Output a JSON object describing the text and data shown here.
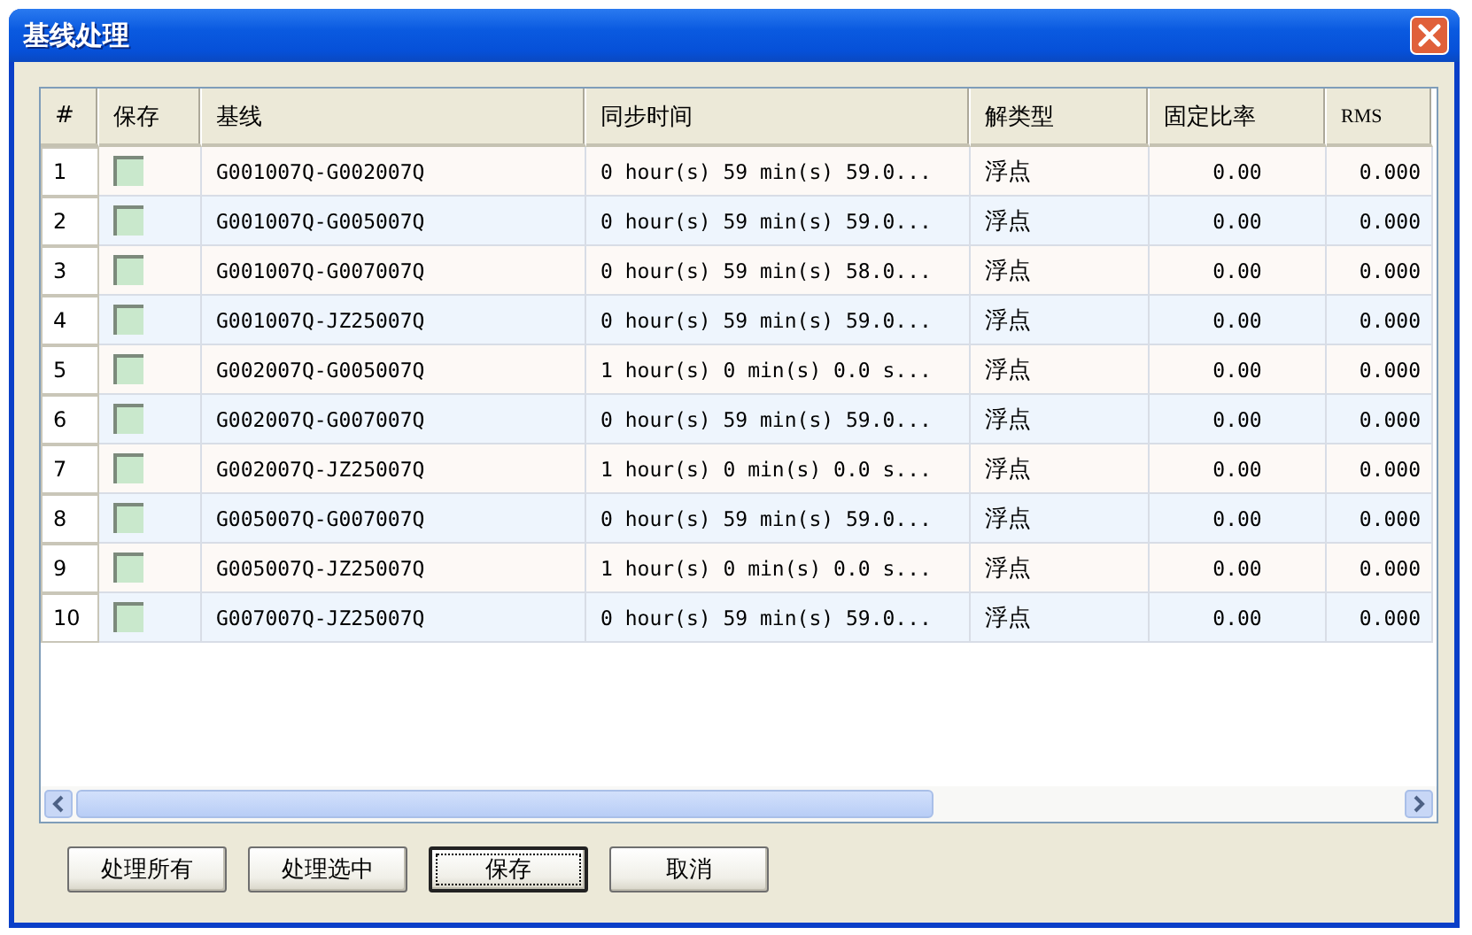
{
  "window": {
    "title": "基线处理"
  },
  "table": {
    "columns": [
      "#",
      "保存",
      "基线",
      "同步时间",
      "解类型",
      "固定比率",
      "RMS"
    ],
    "rows": [
      {
        "index": "1",
        "checked": false,
        "baseline": "G001007Q-G002007Q",
        "sync_time": "0 hour(s) 59 min(s) 59.0...",
        "solution_type": "浮点",
        "fixed_ratio": "0.00",
        "rms": "0.000"
      },
      {
        "index": "2",
        "checked": false,
        "baseline": "G001007Q-G005007Q",
        "sync_time": "0 hour(s) 59 min(s) 59.0...",
        "solution_type": "浮点",
        "fixed_ratio": "0.00",
        "rms": "0.000"
      },
      {
        "index": "3",
        "checked": false,
        "baseline": "G001007Q-G007007Q",
        "sync_time": "0 hour(s) 59 min(s) 58.0...",
        "solution_type": "浮点",
        "fixed_ratio": "0.00",
        "rms": "0.000"
      },
      {
        "index": "4",
        "checked": false,
        "baseline": "G001007Q-JZ25007Q",
        "sync_time": "0 hour(s) 59 min(s) 59.0...",
        "solution_type": "浮点",
        "fixed_ratio": "0.00",
        "rms": "0.000"
      },
      {
        "index": "5",
        "checked": false,
        "baseline": "G002007Q-G005007Q",
        "sync_time": "1 hour(s) 0 min(s) 0.0 s...",
        "solution_type": "浮点",
        "fixed_ratio": "0.00",
        "rms": "0.000"
      },
      {
        "index": "6",
        "checked": false,
        "baseline": "G002007Q-G007007Q",
        "sync_time": "0 hour(s) 59 min(s) 59.0...",
        "solution_type": "浮点",
        "fixed_ratio": "0.00",
        "rms": "0.000"
      },
      {
        "index": "7",
        "checked": false,
        "baseline": "G002007Q-JZ25007Q",
        "sync_time": "1 hour(s) 0 min(s) 0.0 s...",
        "solution_type": "浮点",
        "fixed_ratio": "0.00",
        "rms": "0.000"
      },
      {
        "index": "8",
        "checked": false,
        "baseline": "G005007Q-G007007Q",
        "sync_time": "0 hour(s) 59 min(s) 59.0...",
        "solution_type": "浮点",
        "fixed_ratio": "0.00",
        "rms": "0.000"
      },
      {
        "index": "9",
        "checked": false,
        "baseline": "G005007Q-JZ25007Q",
        "sync_time": "1 hour(s) 0 min(s) 0.0 s...",
        "solution_type": "浮点",
        "fixed_ratio": "0.00",
        "rms": "0.000"
      },
      {
        "index": "10",
        "checked": false,
        "baseline": "G007007Q-JZ25007Q",
        "sync_time": "0 hour(s) 59 min(s) 59.0...",
        "solution_type": "浮点",
        "fixed_ratio": "0.00",
        "rms": "0.000"
      }
    ]
  },
  "buttons": [
    {
      "label": "处理所有",
      "focused": false
    },
    {
      "label": "处理选中",
      "focused": false
    },
    {
      "label": "保存",
      "focused": true
    },
    {
      "label": "取消",
      "focused": false
    }
  ]
}
